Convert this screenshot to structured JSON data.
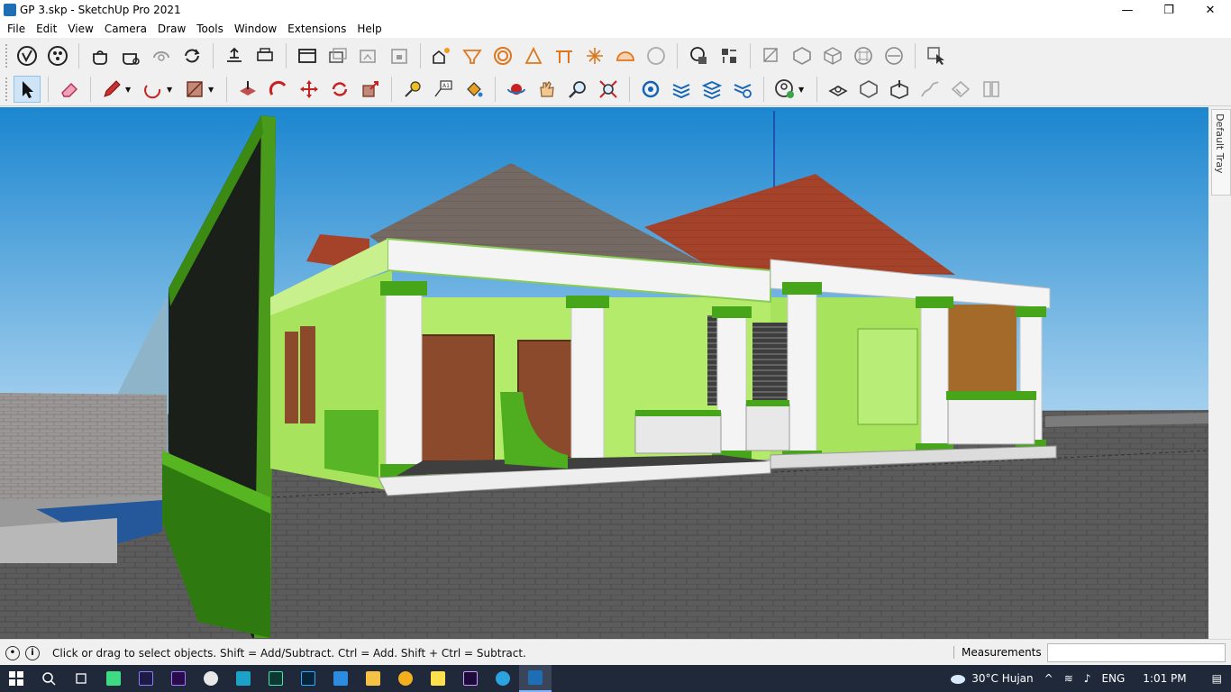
{
  "window": {
    "title": "GP 3.skp - SketchUp Pro 2021",
    "minimize": "—",
    "maximize": "❐",
    "close": "✕"
  },
  "menu": [
    "File",
    "Edit",
    "View",
    "Camera",
    "Draw",
    "Tools",
    "Window",
    "Extensions",
    "Help"
  ],
  "toolbar_row1": [
    "model-info-icon",
    "colors-icon",
    "teapot-icon",
    "teapot-colors-icon",
    "orbit-grey-icon",
    "refresh-icon",
    "align-icon",
    "printer-icon",
    "window-icon",
    "window-stack-icon",
    "window-grey-icon",
    "lock-window-icon",
    "house-sun-icon",
    "tray-icon",
    "target-icon",
    "protractor-icon",
    "table-icon",
    "sparkle-icon",
    "dome-icon",
    "circle-grey-icon",
    "globe-icon",
    "grid-move-icon",
    "view-iso-icon",
    "view-top-icon",
    "view-front-icon",
    "view-right-icon",
    "view-back-icon",
    "view-left-icon",
    "select-box-icon"
  ],
  "toolbar_row2": [
    "select-arrow-icon",
    "eraser-icon",
    "pencil-icon",
    "arc-icon",
    "rectangle-icon",
    "pushpull-icon",
    "followme-icon",
    "move-icon",
    "rotate-icon",
    "scale-icon",
    "tape-icon",
    "text-icon",
    "paint-bucket-icon",
    "orbit-icon",
    "pan-hand-icon",
    "zoom-icon",
    "zoom-extents-icon",
    "component-icon",
    "layers-icon",
    "stack-icon",
    "settings-layers-icon",
    "user-icon",
    "sandbox-icon",
    "box-icon",
    "box-arrow-icon",
    "smoove-icon",
    "drape-icon",
    "flip-icon"
  ],
  "tray": {
    "label": "Default Tray"
  },
  "status": {
    "hint": "Click or drag to select objects. Shift = Add/Subtract. Ctrl = Add. Shift + Ctrl = Subtract.",
    "measurements_label": "Measurements",
    "measurements_value": ""
  },
  "taskbar": {
    "weather": "30°C  Hujan",
    "language": "ENG",
    "time": "1:01 PM"
  },
  "colors": {
    "sky_top": "#2c92d6",
    "sky_bottom": "#b6d8f0",
    "ground": "#5e5e5e",
    "wall_green": "#a8e35d",
    "trim_green": "#46a519",
    "roof_grey": "#7a6f68",
    "roof_red": "#a8432a",
    "column_white": "#f4f4f4",
    "door_brown": "#8a4a2b"
  }
}
